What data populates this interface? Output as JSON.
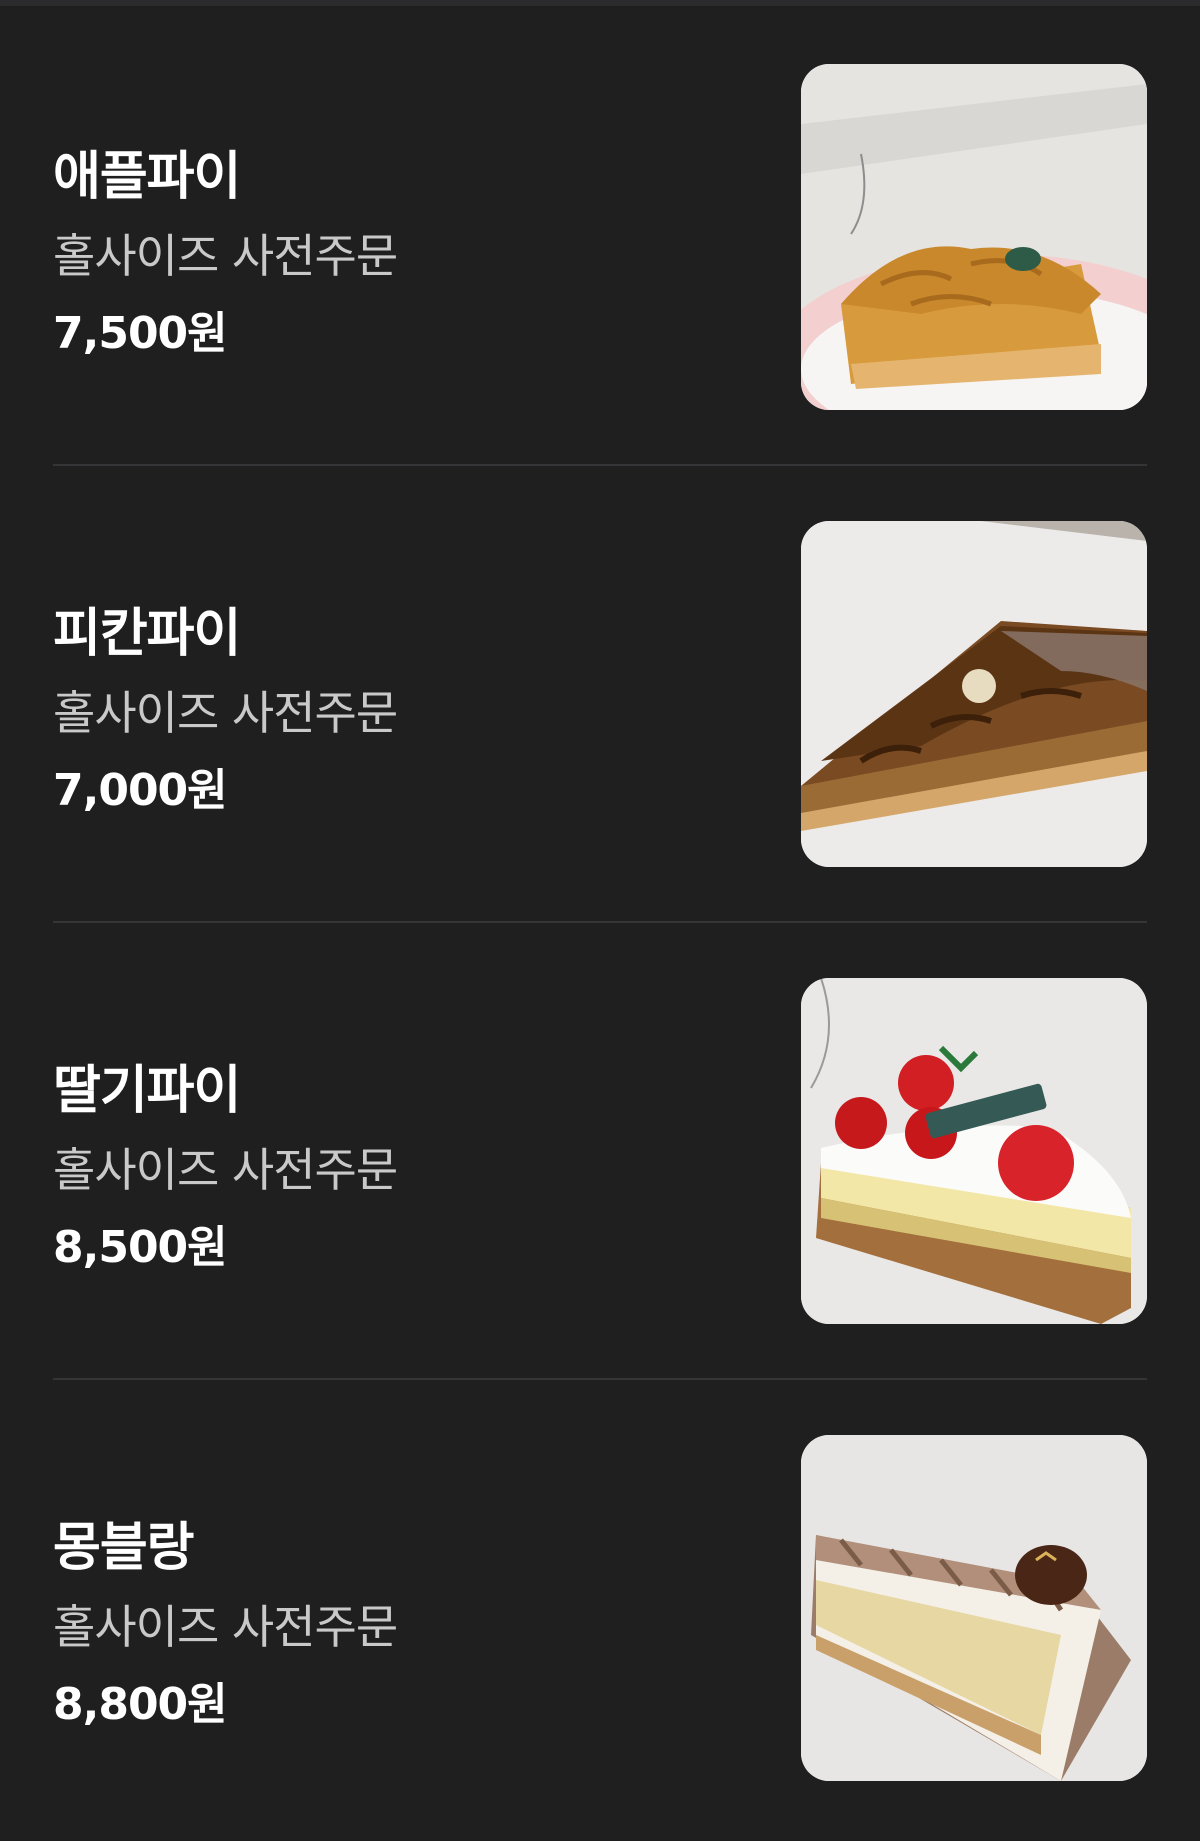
{
  "menu": {
    "items": [
      {
        "name": "애플파이",
        "desc": "홀사이즈 사전주문",
        "price": "7,500원",
        "photo": "apple-pie-photo"
      },
      {
        "name": "피칸파이",
        "desc": "홀사이즈 사전주문",
        "price": "7,000원",
        "photo": "pecan-pie-photo"
      },
      {
        "name": "딸기파이",
        "desc": "홀사이즈 사전주문",
        "price": "8,500원",
        "photo": "strawberry-pie-photo"
      },
      {
        "name": "몽블랑",
        "desc": "홀사이즈 사전주문",
        "price": "8,800원",
        "photo": "mont-blanc-photo"
      }
    ]
  },
  "colors": {
    "background": "#1f1f20",
    "divider": "#353537",
    "title": "#ffffff",
    "description": "#c9c9c9"
  }
}
